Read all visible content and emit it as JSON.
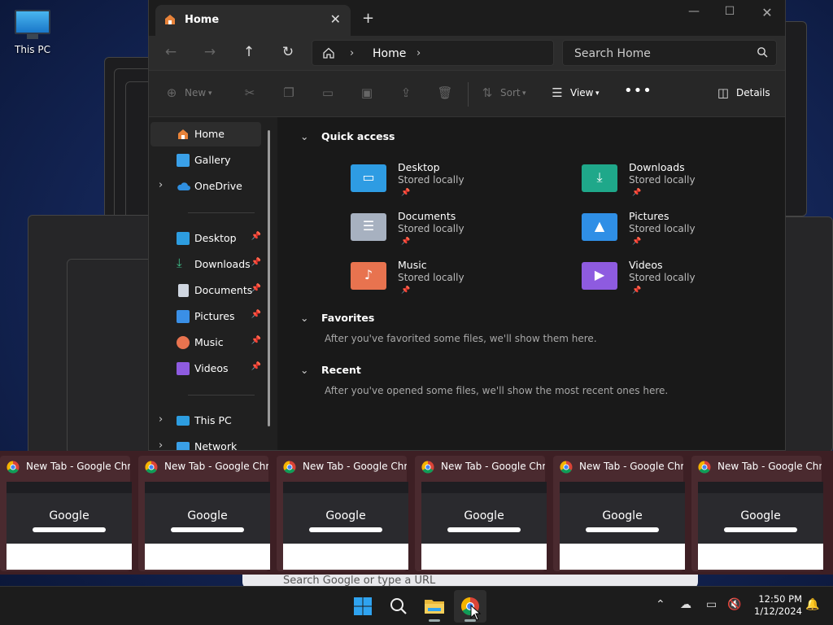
{
  "desktop": {
    "icon_label": "This PC"
  },
  "explorer": {
    "tab_title": "Home",
    "address": {
      "crumb": "Home"
    },
    "search": {
      "placeholder": "Search Home"
    },
    "toolbar": {
      "new": "New",
      "sort": "Sort",
      "view": "View",
      "details": "Details"
    },
    "sidebar": {
      "items": [
        {
          "label": "Home",
          "color": "#e8833a"
        },
        {
          "label": "Gallery",
          "color": "#3aa0e8"
        },
        {
          "label": "OneDrive",
          "color": "#2f8fe0"
        },
        {
          "label": "Desktop",
          "color": "#2d9de0"
        },
        {
          "label": "Downloads",
          "color": "#3ebf8a"
        },
        {
          "label": "Documents",
          "color": "#cfd6e0"
        },
        {
          "label": "Pictures",
          "color": "#3a8fe6"
        },
        {
          "label": "Music",
          "color": "#e8734f"
        },
        {
          "label": "Videos",
          "color": "#8e5be0"
        },
        {
          "label": "This PC",
          "color": "#2d9de0"
        },
        {
          "label": "Network",
          "color": "#3aa0e8"
        }
      ]
    },
    "quick_access": {
      "title": "Quick access",
      "items": [
        {
          "name": "Desktop",
          "sub": "Stored locally",
          "color": "#2e9ce3"
        },
        {
          "name": "Downloads",
          "sub": "Stored locally",
          "color": "#1fa88a"
        },
        {
          "name": "Documents",
          "sub": "Stored locally",
          "color": "#a7b1c0"
        },
        {
          "name": "Pictures",
          "sub": "Stored locally",
          "color": "#2f8fe6"
        },
        {
          "name": "Music",
          "sub": "Stored locally",
          "color": "#e8734f"
        },
        {
          "name": "Videos",
          "sub": "Stored locally",
          "color": "#8e5be0"
        }
      ]
    },
    "favorites": {
      "title": "Favorites",
      "empty": "After you've favorited some files, we'll show them here."
    },
    "recent": {
      "title": "Recent",
      "empty": "After you've opened some files, we'll show the most recent ones here."
    }
  },
  "thumbnails": {
    "items": [
      {
        "title": "New Tab - Google Chr...",
        "logo": "Google"
      },
      {
        "title": "New Tab - Google Chr...",
        "logo": "Google"
      },
      {
        "title": "New Tab - Google Chr...",
        "logo": "Google"
      },
      {
        "title": "New Tab - Google Chr...",
        "logo": "Google"
      },
      {
        "title": "New Tab - Google Chr...",
        "logo": "Google"
      },
      {
        "title": "New Tab - Google Chr...",
        "logo": "Google"
      }
    ]
  },
  "chrome_search": {
    "placeholder": "Search Google or type a URL"
  },
  "taskbar": {
    "time": "12:50 PM",
    "date": "1/12/2024"
  }
}
